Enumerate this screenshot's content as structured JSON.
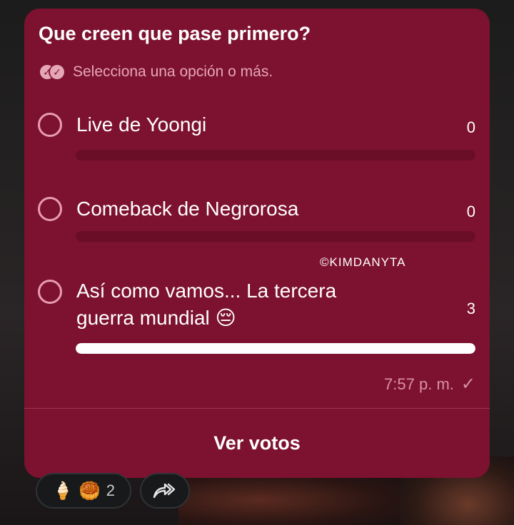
{
  "poll": {
    "question": "Que creen que pase primero?",
    "instruction": "Selecciona una opción o más.",
    "options": [
      {
        "label": "Live de Yoongi",
        "votes": "0",
        "fraction": 0
      },
      {
        "label": "Comeback de Negrorosa",
        "votes": "0",
        "fraction": 0
      },
      {
        "label_line1": "Así como vamos... La tercera",
        "label_line2": "guerra mundial 😔",
        "votes": "3",
        "fraction": 1
      }
    ],
    "watermark": "©KIMDANYTA",
    "time": "7:57 p. m.",
    "view_votes_label": "Ver votos"
  },
  "reactions": {
    "emoji1": "🍦",
    "emoji2": "🥮",
    "count": "2"
  },
  "icons": {
    "double_check": "double-check-icon",
    "sent_check": "check-icon",
    "forward": "forward-icon"
  },
  "colors": {
    "card": "#7d1130",
    "accent": "#e79cb0",
    "bar_track": "#6a0e27"
  }
}
